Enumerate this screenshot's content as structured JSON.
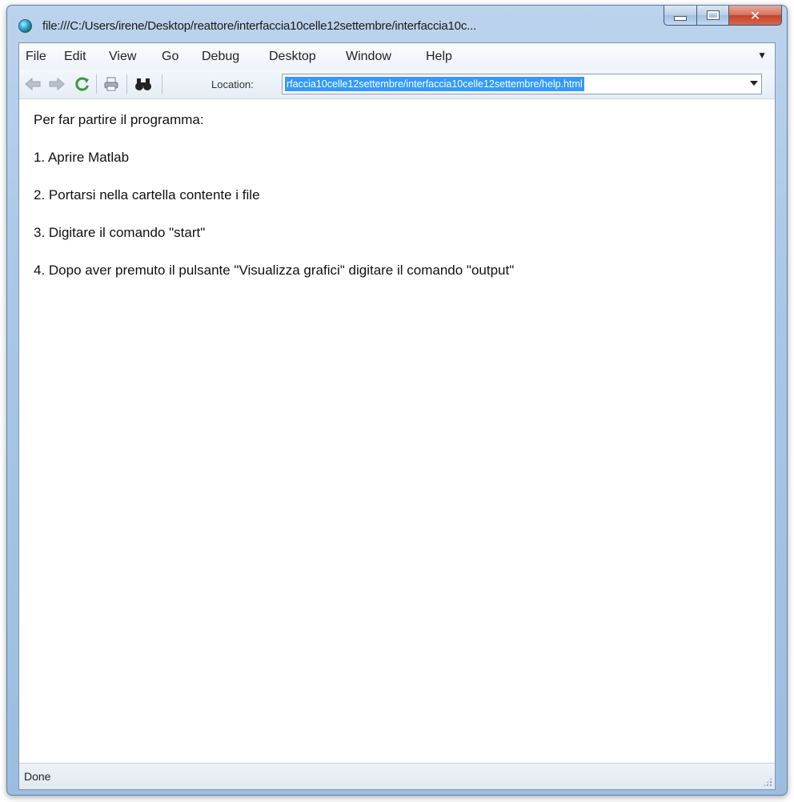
{
  "window": {
    "title": "file:///C:/Users/irene/Desktop/reattore/interfaccia10celle12settembre/interfaccia10c..."
  },
  "menubar": {
    "items": [
      "File",
      "Edit",
      "View",
      "Go",
      "Debug",
      "Desktop",
      "Window",
      "Help"
    ]
  },
  "toolbar": {
    "location_label": "Location:",
    "location_value": "rfaccia10celle12settembre/interfaccia10celle12settembre/help.html"
  },
  "content": {
    "lines": [
      "Per far partire il programma:",
      "1. Aprire Matlab",
      "2. Portarsi nella cartella contente i file",
      "3. Digitare il comando \"start\"",
      "4. Dopo aver premuto il pulsante \"Visualizza grafici\" digitare il comando \"output\""
    ]
  },
  "statusbar": {
    "text": "Done"
  },
  "colors": {
    "selection": "#3399ff",
    "close_button": "#c4432a",
    "frame": "#a9c6e6"
  },
  "icons": [
    "globe-icon",
    "back-arrow-icon",
    "forward-arrow-icon",
    "refresh-icon",
    "print-icon",
    "find-binoculars-icon"
  ]
}
